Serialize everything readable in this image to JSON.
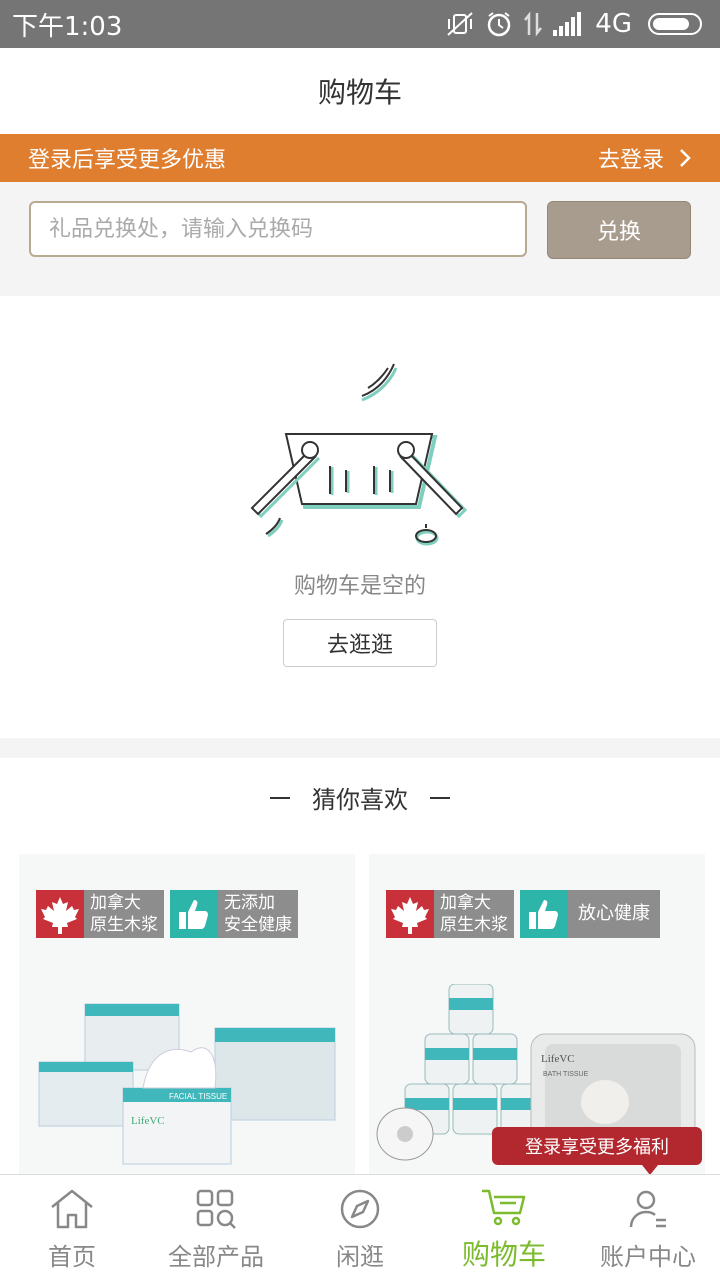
{
  "status_bar": {
    "time": "下午1:03",
    "network": "4G"
  },
  "header": {
    "title": "购物车"
  },
  "login_banner": {
    "message": "登录后享受更多优惠",
    "action": "去登录"
  },
  "redeem": {
    "placeholder": "礼品兑换处，请输入兑换码",
    "value": "",
    "button": "兑换"
  },
  "empty_cart": {
    "message": "购物车是空的",
    "button": "去逛逛"
  },
  "recommend": {
    "title": "猜你喜欢",
    "products": [
      {
        "badges": [
          {
            "icon": "maple-leaf-icon",
            "color": "#c8303a",
            "line1": "加拿大",
            "line2": "原生木浆"
          },
          {
            "icon": "thumbs-up-icon",
            "color": "#2eb5a9",
            "line1": "无添加",
            "line2": "安全健康"
          }
        ],
        "brand": "LifeVC",
        "package_label": "FACIAL TISSUE"
      },
      {
        "badges": [
          {
            "icon": "maple-leaf-icon",
            "color": "#c8303a",
            "line1": "加拿大",
            "line2": "原生木浆"
          },
          {
            "icon": "thumbs-up-icon",
            "color": "#2eb5a9",
            "line1": "放心健康",
            "line2": ""
          }
        ],
        "brand": "LifeVC",
        "package_label": "BATH TISSUE"
      }
    ]
  },
  "promo_tip": "登录享受更多福利",
  "bottom_nav": {
    "items": [
      {
        "label": "首页",
        "icon": "home-icon"
      },
      {
        "label": "全部产品",
        "icon": "grid-search-icon"
      },
      {
        "label": "闲逛",
        "icon": "compass-icon"
      },
      {
        "label": "购物车",
        "icon": "cart-icon"
      },
      {
        "label": "账户中心",
        "icon": "user-icon"
      }
    ],
    "active_index": 3
  },
  "colors": {
    "banner": "#e07e30",
    "active": "#7cbb2e",
    "tip": "#b3282f"
  }
}
